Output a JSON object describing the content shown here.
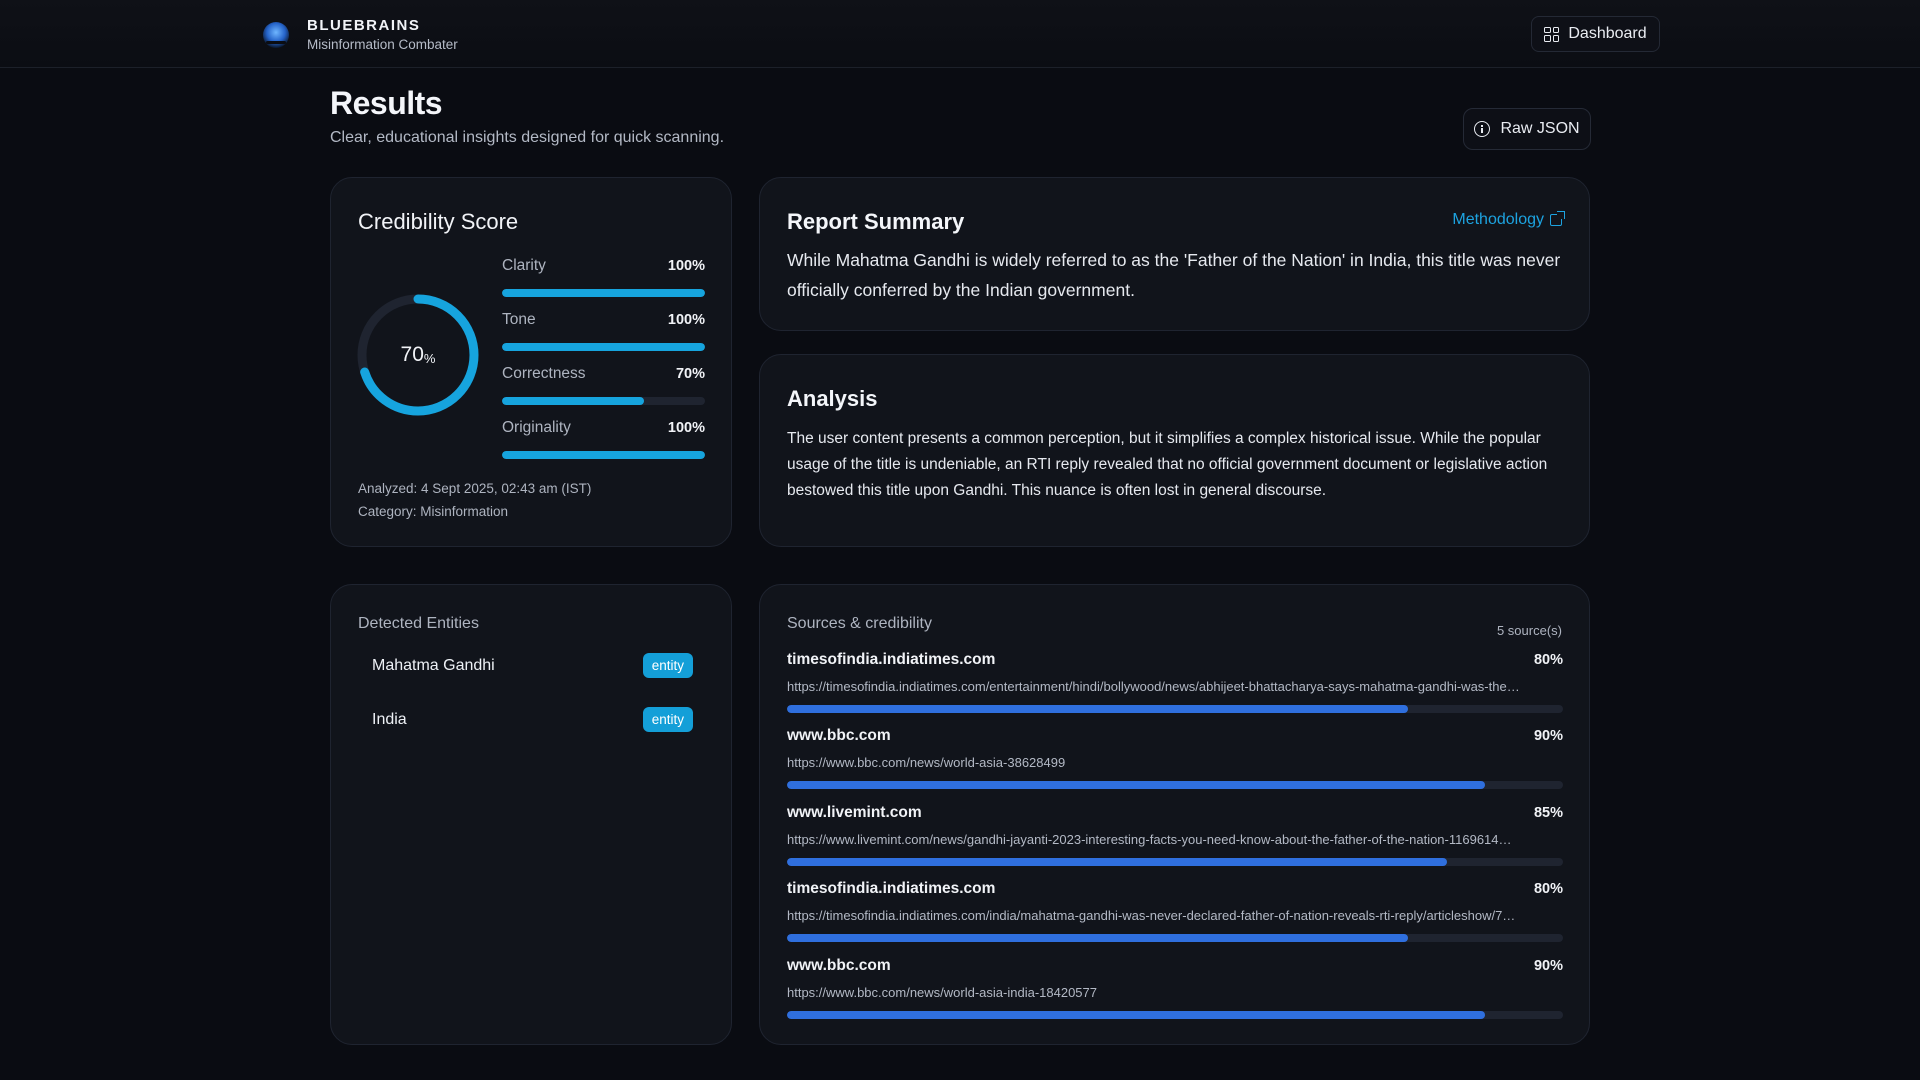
{
  "brand": {
    "name": "BLUEBRAINS",
    "tagline": "Misinformation Combater"
  },
  "nav": {
    "dashboard_label": "Dashboard"
  },
  "header": {
    "title": "Results",
    "subtitle": "Clear, educational insights designed for quick scanning.",
    "raw_json_label": "Raw JSON"
  },
  "credibility": {
    "title": "Credibility Score",
    "score": "70",
    "score_unit": "%",
    "score_value": 0.7,
    "metrics": [
      {
        "label": "Clarity",
        "value": "100%",
        "fraction": 1.0
      },
      {
        "label": "Tone",
        "value": "100%",
        "fraction": 1.0
      },
      {
        "label": "Correctness",
        "value": "70%",
        "fraction": 0.7
      },
      {
        "label": "Originality",
        "value": "100%",
        "fraction": 1.0
      }
    ],
    "analyzed": "Analyzed: 4 Sept 2025, 02:43 am (IST)",
    "category": "Category: Misinformation"
  },
  "summary": {
    "title": "Report Summary",
    "methodology_label": "Methodology",
    "text": "While Mahatma Gandhi is widely referred to as the 'Father of the Nation' in India, this title was never officially conferred by the Indian government."
  },
  "analysis": {
    "title": "Analysis",
    "text": "The user content presents a common perception, but it simplifies a complex historical issue. While the popular usage of the title is undeniable, an RTI reply revealed that no official government document or legislative action bestowed this title upon Gandhi. This nuance is often lost in general discourse."
  },
  "entities": {
    "title": "Detected Entities",
    "items": [
      {
        "name": "Mahatma Gandhi",
        "badge": "entity"
      },
      {
        "name": "India",
        "badge": "entity"
      }
    ]
  },
  "sources": {
    "title": "Sources & credibility",
    "count": "5 source(s)",
    "items": [
      {
        "domain": "timesofindia.indiatimes.com",
        "pct": "80%",
        "fraction": 0.8,
        "url": "https://timesofindia.indiatimes.com/entertainment/hindi/bollywood/news/abhijeet-bhattacharya-says-mahatma-gandhi-was-the…"
      },
      {
        "domain": "www.bbc.com",
        "pct": "90%",
        "fraction": 0.9,
        "url": "https://www.bbc.com/news/world-asia-38628499"
      },
      {
        "domain": "www.livemint.com",
        "pct": "85%",
        "fraction": 0.85,
        "url": "https://www.livemint.com/news/gandhi-jayanti-2023-interesting-facts-you-need-know-about-the-father-of-the-nation-1169614…"
      },
      {
        "domain": "timesofindia.indiatimes.com",
        "pct": "80%",
        "fraction": 0.8,
        "url": "https://timesofindia.indiatimes.com/india/mahatma-gandhi-was-never-declared-father-of-nation-reveals-rti-reply/articleshow/7…"
      },
      {
        "domain": "www.bbc.com",
        "pct": "90%",
        "fraction": 0.9,
        "url": "https://www.bbc.com/news/world-asia-india-18420577"
      }
    ]
  },
  "colors": {
    "accent": "#16a4de",
    "source_bar": "#2f6fde",
    "background": "#0a0c12",
    "card": "#11141b"
  }
}
